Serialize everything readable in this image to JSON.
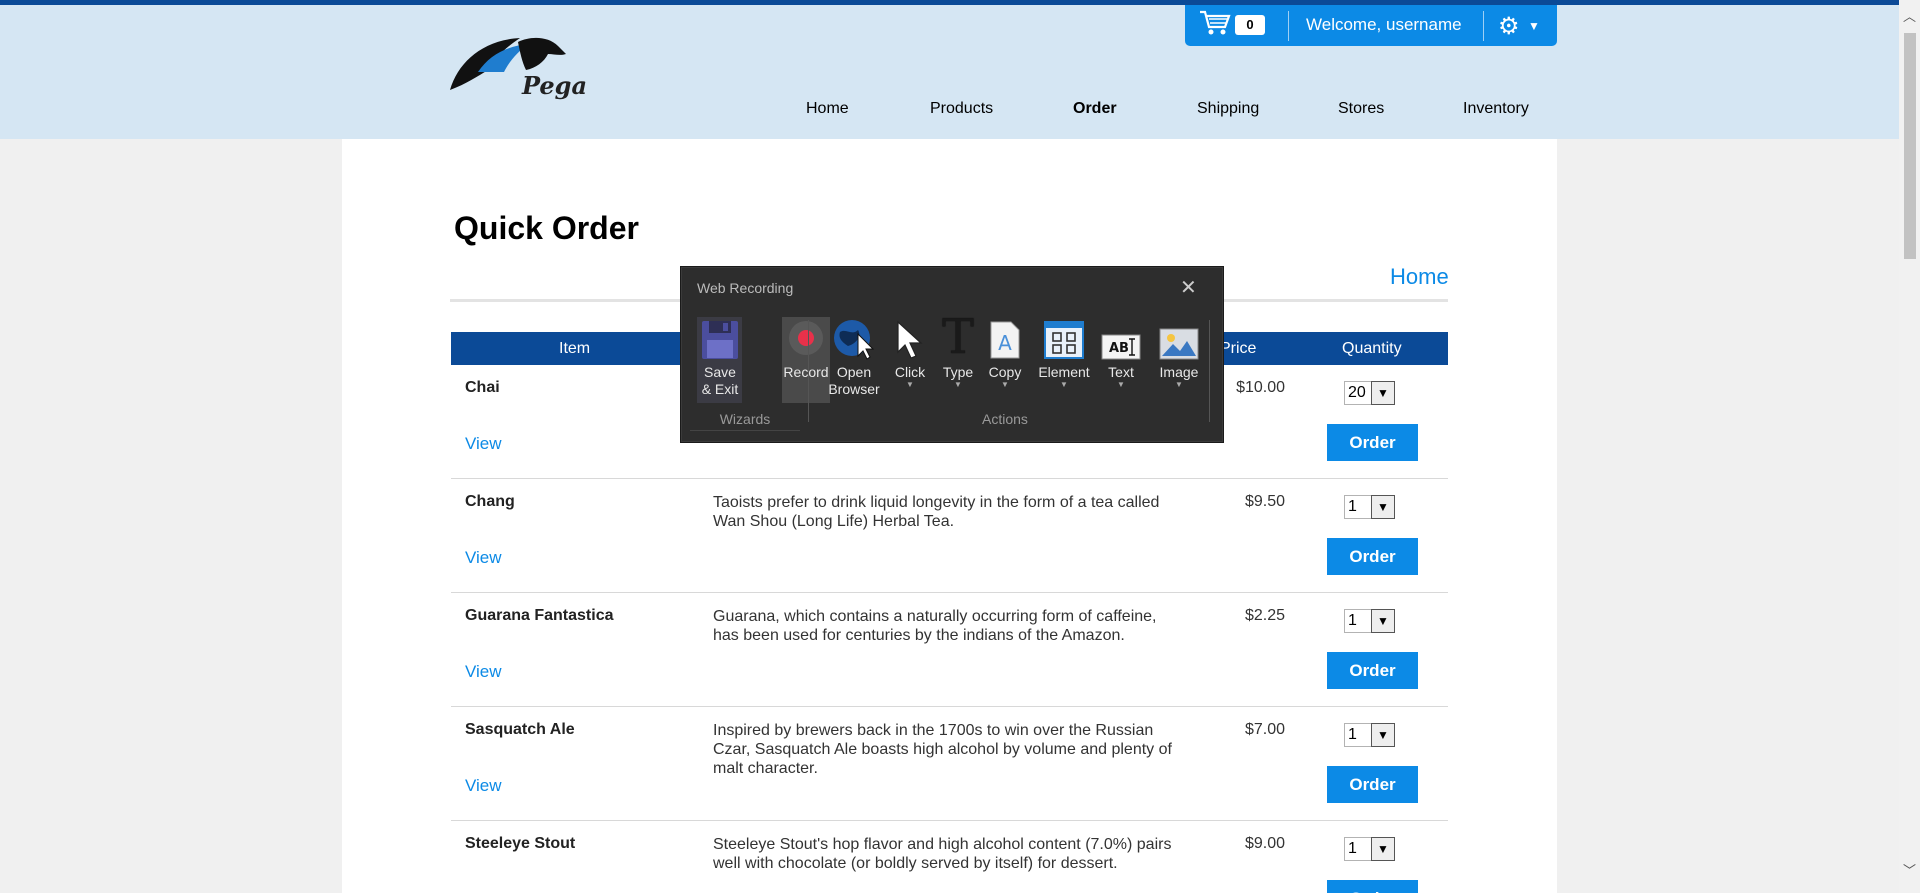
{
  "header": {
    "logo_text": "Pega",
    "cart_count": "0",
    "welcome": "Welcome, username",
    "nav": [
      "Home",
      "Products",
      "Order",
      "Shipping",
      "Stores",
      "Inventory"
    ],
    "active_nav": "Order"
  },
  "page": {
    "title": "Quick Order",
    "home_link": "Home"
  },
  "table": {
    "columns": [
      "Item",
      "Price",
      "Quantity"
    ],
    "view_label": "View",
    "order_label": "Order",
    "rows": [
      {
        "name": "Chai",
        "description": "",
        "price": "$10.00",
        "qty": "20"
      },
      {
        "name": "Chang",
        "description": "Taoists prefer to drink liquid longevity in the form of a tea called Wan Shou (Long Life) Herbal Tea.",
        "price": "$9.50",
        "qty": "1"
      },
      {
        "name": "Guarana Fantastica",
        "description": "Guarana, which contains a naturally occurring form of caffeine, has been used for centuries by the indians of the Amazon.",
        "price": "$2.25",
        "qty": "1"
      },
      {
        "name": "Sasquatch Ale",
        "description": "Inspired by brewers back in the 1700s to win over the Russian Czar, Sasquatch Ale boasts high alcohol by volume and plenty of malt character.",
        "price": "$7.00",
        "qty": "1"
      },
      {
        "name": "Steeleye Stout",
        "description": "Steeleye Stout's hop flavor and high alcohol content (7.0%) pairs well with chocolate (or boldly served by itself) for dessert.",
        "price": "$9.00",
        "qty": "1"
      }
    ]
  },
  "recorder": {
    "title": "Web Recording",
    "wizards_label": "Wizards",
    "actions_label": "Actions",
    "save_line1": "Save",
    "save_line2": "& Exit",
    "record": "Record",
    "open_line1": "Open",
    "open_line2": "Browser",
    "click": "Click",
    "type": "Type",
    "copy": "Copy",
    "element": "Element",
    "text": "Text",
    "image": "Image"
  },
  "colors": {
    "brand_blue": "#0c8ae6",
    "dark_blue": "#0b4a97",
    "header_bg": "#d5e6f3"
  }
}
